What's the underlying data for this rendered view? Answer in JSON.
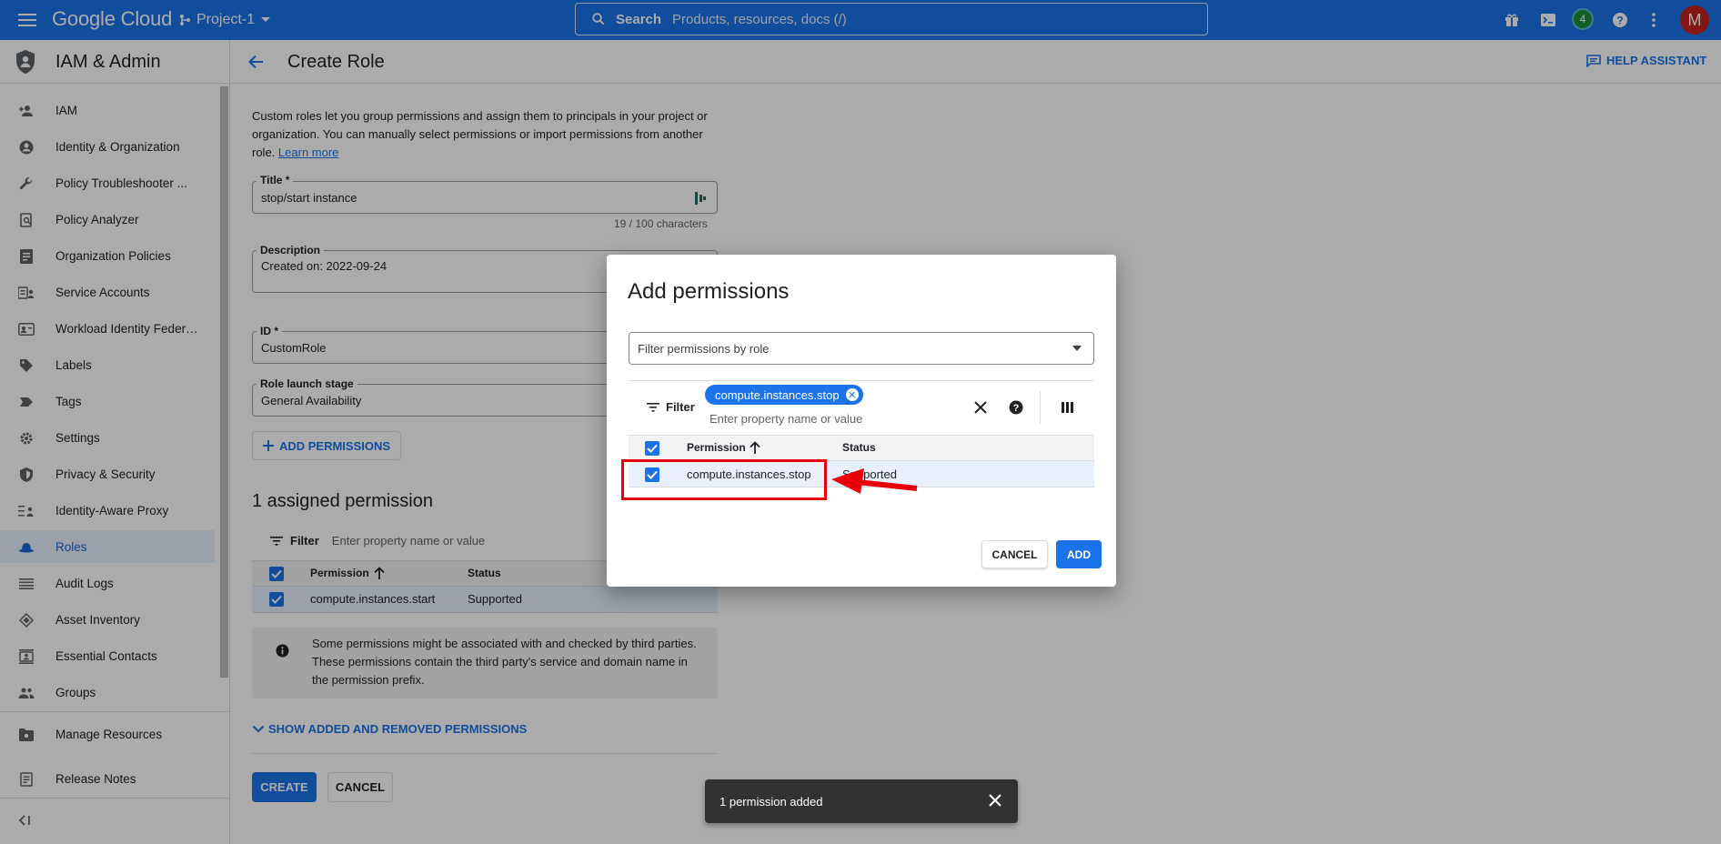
{
  "topbar": {
    "logo_text": "Google Cloud",
    "project": "Project-1",
    "search_label": "Search",
    "search_placeholder": "Products, resources, docs (/)",
    "notification_count": "4",
    "avatar_letter": "M"
  },
  "sidebar": {
    "title": "IAM & Admin",
    "items": [
      {
        "label": "IAM",
        "icon": "person-add-icon"
      },
      {
        "label": "Identity & Organization",
        "icon": "account-circle-icon"
      },
      {
        "label": "Policy Troubleshooter ...",
        "icon": "wrench-icon"
      },
      {
        "label": "Policy Analyzer",
        "icon": "policy-search-icon"
      },
      {
        "label": "Organization Policies",
        "icon": "list-doc-icon"
      },
      {
        "label": "Service Accounts",
        "icon": "service-account-icon"
      },
      {
        "label": "Workload Identity Federat...",
        "icon": "id-card-icon"
      },
      {
        "label": "Labels",
        "icon": "tag-icon"
      },
      {
        "label": "Tags",
        "icon": "label-arrow-icon"
      },
      {
        "label": "Settings",
        "icon": "gear-icon"
      },
      {
        "label": "Privacy & Security",
        "icon": "shield-icon"
      },
      {
        "label": "Identity-Aware Proxy",
        "icon": "proxy-icon"
      },
      {
        "label": "Roles",
        "icon": "hat-icon"
      },
      {
        "label": "Audit Logs",
        "icon": "lines-icon"
      },
      {
        "label": "Asset Inventory",
        "icon": "diamond-icon"
      },
      {
        "label": "Essential Contacts",
        "icon": "contacts-icon"
      },
      {
        "label": "Groups",
        "icon": "group-icon"
      },
      {
        "label": "Manage Resources",
        "icon": "folder-gear-icon"
      },
      {
        "label": "Release Notes",
        "icon": "notes-icon"
      }
    ],
    "active_index": 12
  },
  "header": {
    "title": "Create Role",
    "help_assistant": "HELP ASSISTANT"
  },
  "form": {
    "intro_text": "Custom roles let you group permissions and assign them to principals in your project or organization. You can manually select permissions or import permissions from another role.",
    "learn_more": "Learn more",
    "title_label": "Title *",
    "title_value": "stop/start instance",
    "char_count": "19 / 100 characters",
    "description_label": "Description",
    "description_value": "Created on: 2022-09-24",
    "id_label": "ID *",
    "id_value": "CustomRole",
    "stage_label": "Role launch stage",
    "stage_value": "General Availability",
    "add_permissions": "ADD PERMISSIONS"
  },
  "assigned": {
    "title": "1 assigned permission",
    "filter_label": "Filter",
    "filter_placeholder": "Enter property name or value",
    "col_permission": "Permission",
    "col_status": "Status",
    "rows": [
      {
        "permission": "compute.instances.start",
        "status": "Supported"
      }
    ],
    "info_text": "Some permissions might be associated with and checked by third parties. These permissions contain the third party's service and domain name in the permission prefix.",
    "show_added_removed": "SHOW ADDED AND REMOVED PERMISSIONS",
    "create": "CREATE",
    "cancel": "CANCEL"
  },
  "modal": {
    "title": "Add permissions",
    "role_filter_placeholder": "Filter permissions by role",
    "filter_label": "Filter",
    "chip": "compute.instances.stop",
    "filter_placeholder": "Enter property name or value",
    "col_permission": "Permission",
    "col_status": "Status",
    "rows": [
      {
        "permission": "compute.instances.stop",
        "status": "Supported"
      }
    ],
    "cancel": "CANCEL",
    "add": "ADD"
  },
  "snackbar": {
    "message": "1 permission added"
  },
  "colors": {
    "primary": "#1a73e8",
    "annotation_red": "#e8000b"
  }
}
